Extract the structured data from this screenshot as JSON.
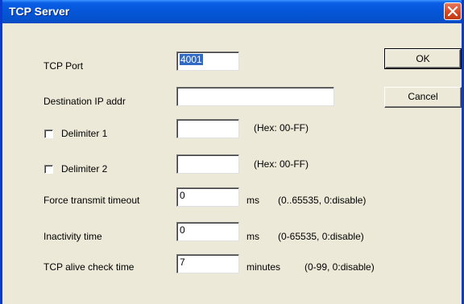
{
  "window": {
    "title": "TCP Server"
  },
  "buttons": {
    "ok": "OK",
    "cancel": "Cancel"
  },
  "fields": {
    "tcp_port": {
      "label": "TCP Port",
      "value": "4001"
    },
    "dest_ip": {
      "label": "Destination IP addr",
      "value": ""
    },
    "delimiter1": {
      "label": "Delimiter 1",
      "value": "",
      "hint": "(Hex: 00-FF)",
      "checked": false
    },
    "delimiter2": {
      "label": "Delimiter 2",
      "value": "",
      "hint": "(Hex: 00-FF)",
      "checked": false
    },
    "force_timeout": {
      "label": "Force transmit timeout",
      "value": "0",
      "unit": "ms",
      "hint": "(0..65535, 0:disable)"
    },
    "inactivity": {
      "label": "Inactivity time",
      "value": "0",
      "unit": "ms",
      "hint": "(0-65535, 0:disable)"
    },
    "alive_check": {
      "label": "TCP alive check time",
      "value": "7",
      "unit": "minutes",
      "hint": "(0-99, 0:disable)"
    }
  }
}
